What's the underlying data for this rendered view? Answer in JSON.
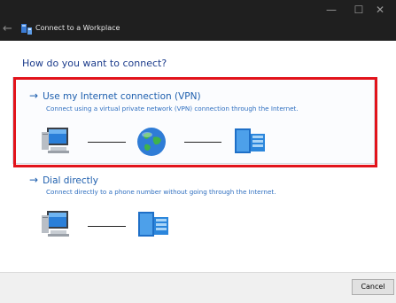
{
  "window": {
    "title": "Connect to a Workplace",
    "minimize_glyph": "—",
    "maximize_glyph": "☐",
    "close_glyph": "✕",
    "back_glyph": "←"
  },
  "heading": "How do you want to connect?",
  "options": [
    {
      "title": "Use my Internet connection (VPN)",
      "description": "Connect using a virtual private network (VPN) connection through the Internet.",
      "icons": [
        "computer-icon",
        "globe-icon",
        "server-icon"
      ]
    },
    {
      "title": "Dial directly",
      "description": "Connect directly to a phone number without going through the Internet.",
      "icons": [
        "computer-icon",
        "server-icon"
      ]
    }
  ],
  "arrow_glyph": "→",
  "footer": {
    "cancel_label": "Cancel"
  },
  "colors": {
    "link": "#1e5fae",
    "highlight": "#e2131b",
    "titlebar": "#1f1f1f"
  }
}
